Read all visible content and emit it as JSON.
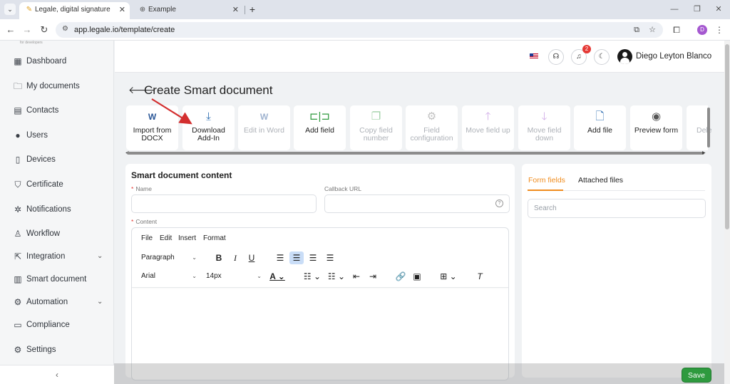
{
  "browser": {
    "tabs": [
      {
        "title": "Legale, digital signature",
        "favicon": "pen-icon",
        "active": true
      },
      {
        "title": "Example",
        "favicon": "globe-icon",
        "active": false
      }
    ],
    "url": "app.legale.io/template/create",
    "profile_initial": "D"
  },
  "sidebar": {
    "logo_text": "for developers",
    "items": [
      {
        "label": "Dashboard",
        "icon": "dashboard-icon",
        "glyph": "▦"
      },
      {
        "label": "My documents",
        "icon": "folder-icon",
        "glyph": "🗀"
      },
      {
        "label": "Contacts",
        "icon": "contacts-icon",
        "glyph": "▤"
      },
      {
        "label": "Users",
        "icon": "user-circle-icon",
        "glyph": "●"
      },
      {
        "label": "Devices",
        "icon": "device-icon",
        "glyph": "▯"
      },
      {
        "label": "Certificate",
        "icon": "shield-check-icon",
        "glyph": "⛉"
      },
      {
        "label": "Notifications",
        "icon": "bell-icon",
        "glyph": "✲"
      },
      {
        "label": "Workflow",
        "icon": "workflow-icon",
        "glyph": "♙"
      },
      {
        "label": "Integration",
        "icon": "external-link-icon",
        "glyph": "⇱",
        "expandable": true
      },
      {
        "label": "Smart document",
        "icon": "smart-document-icon",
        "glyph": "▥"
      },
      {
        "label": "Automation",
        "icon": "automation-icon",
        "glyph": "⚙",
        "expandable": true
      },
      {
        "label": "Compliance",
        "icon": "chat-icon",
        "glyph": "▭"
      },
      {
        "label": "Settings",
        "icon": "settings-icon",
        "glyph": "⚙"
      }
    ],
    "collapse_glyph": "‹"
  },
  "topbar": {
    "notification_count": "2",
    "user_name": "Diego Leyton Blanco"
  },
  "page": {
    "title": "Create Smart document"
  },
  "toolbar": [
    {
      "label": "Import from DOCX",
      "icon": "word-import-icon",
      "glyph": "W",
      "color": "#2b5797",
      "disabled": false
    },
    {
      "label": "Download Add-In",
      "icon": "download-icon",
      "glyph": "⤓",
      "color": "#2b6cb0",
      "disabled": false
    },
    {
      "label": "Edit in Word",
      "icon": "word-edit-icon",
      "glyph": "W",
      "color": "#2b5797",
      "disabled": true
    },
    {
      "label": "Add field",
      "icon": "add-field-icon",
      "glyph": "⊏|⊐",
      "color": "#2e9a3e",
      "disabled": false
    },
    {
      "label": "Copy field number",
      "icon": "copy-icon",
      "glyph": "❐",
      "color": "#2e9a3e",
      "disabled": true
    },
    {
      "label": "Field configuration",
      "icon": "gear-icon",
      "glyph": "⚙",
      "color": "#777777",
      "disabled": true
    },
    {
      "label": "Move field up",
      "icon": "arrow-up-icon",
      "glyph": "🡑",
      "color": "#9c4dcc",
      "disabled": true
    },
    {
      "label": "Move field down",
      "icon": "arrow-down-icon",
      "glyph": "🡓",
      "color": "#9c4dcc",
      "disabled": true
    },
    {
      "label": "Add file",
      "icon": "add-file-icon",
      "glyph": "🗋",
      "color": "#2b6cb0",
      "disabled": false
    },
    {
      "label": "Preview form",
      "icon": "eye-icon",
      "glyph": "◉",
      "color": "#555555",
      "disabled": false
    },
    {
      "label": "Dele",
      "icon": "delete-icon",
      "glyph": "",
      "color": "#aaaaaa",
      "disabled": true
    }
  ],
  "form": {
    "section_title": "Smart document content",
    "name_label": "Name",
    "name_value": "",
    "callback_label": "Callback URL",
    "callback_value": "",
    "content_label": "Content"
  },
  "editor": {
    "menu": [
      "File",
      "Edit",
      "Insert",
      "Format"
    ],
    "block_format": "Paragraph",
    "font_family": "Arial",
    "font_size": "14px"
  },
  "right_panel": {
    "tabs": [
      "Form fields",
      "Attached files"
    ],
    "search_placeholder": "Search"
  },
  "footer": {
    "save_label": "Save"
  },
  "colors": {
    "accent_orange": "#f08c1e",
    "save_green": "#2e9a3e",
    "annotation_red": "#d32f2f"
  }
}
